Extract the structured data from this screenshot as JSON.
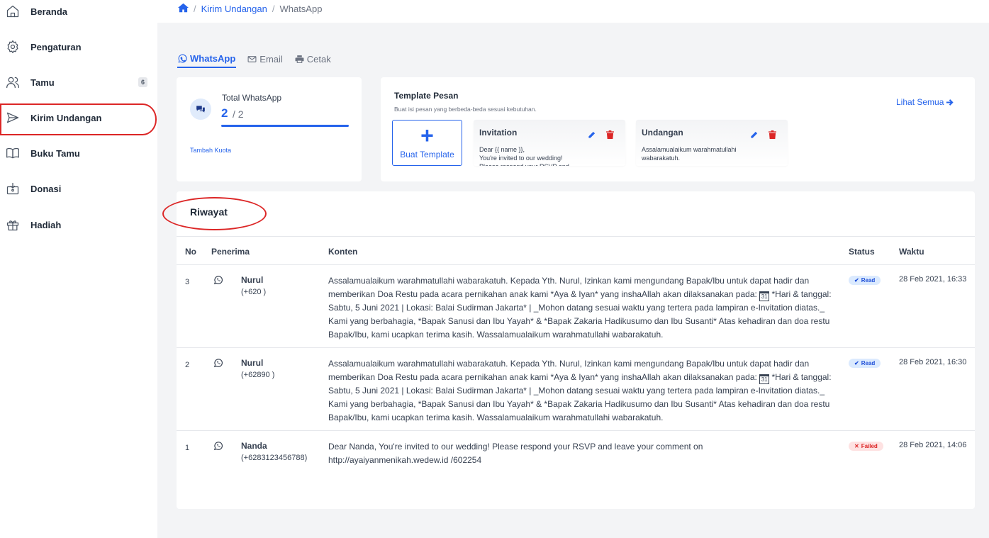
{
  "sidebar": {
    "items": [
      {
        "label": "Beranda",
        "icon": "home-icon"
      },
      {
        "label": "Pengaturan",
        "icon": "gear-icon"
      },
      {
        "label": "Tamu",
        "icon": "users-icon",
        "badge": "6"
      },
      {
        "label": "Kirim Undangan",
        "icon": "send-icon"
      },
      {
        "label": "Buku Tamu",
        "icon": "book-icon"
      },
      {
        "label": "Donasi",
        "icon": "donation-icon"
      },
      {
        "label": "Hadiah",
        "icon": "gift-icon"
      }
    ]
  },
  "breadcrumb": {
    "link": "Kirim Undangan",
    "current": "WhatsApp"
  },
  "tabs": [
    {
      "label": "WhatsApp",
      "icon": "whatsapp-icon",
      "active": true
    },
    {
      "label": "Email",
      "icon": "mail-icon",
      "active": false
    },
    {
      "label": "Cetak",
      "icon": "printer-icon",
      "active": false
    }
  ],
  "whatsapp_card": {
    "title": "Total WhatsApp",
    "used": "2",
    "total": "/ 2",
    "progress": 1.0,
    "link": "Tambah Kuota"
  },
  "template_card": {
    "title": "Template Pesan",
    "subtitle": "Buat isi pesan yang berbeda-beda sesuai kebutuhan.",
    "see_all": "Lihat Semua",
    "create_label": "Buat Template",
    "templates": [
      {
        "name": "Invitation",
        "body": "Dear {{ name }},\nYou're invited to our wedding!\nPlease respond your RSVP and"
      },
      {
        "name": "Undangan",
        "body": "Assalamualaikum warahmatullahi wabarakatuh."
      }
    ]
  },
  "history": {
    "title": "Riwayat",
    "columns": [
      "No",
      "Penerima",
      "Konten",
      "Status",
      "Waktu"
    ],
    "rows": [
      {
        "no": "3",
        "name": "Nurul",
        "phone": "(+620            )",
        "content_before": "Assalamualaikum warahmatullahi wabarakatuh. Kepada Yth. Nurul, Izinkan kami mengundang Bapak/Ibu untuk dapat hadir dan memberikan Doa Restu pada acara pernikahan anak kami *Aya & Iyan* yang inshaAllah akan dilaksanakan pada: ",
        "content_after": " *Hari & tanggal: Sabtu, 5 Juni 2021 | Lokasi: Balai Sudirman Jakarta* | _Mohon datang sesuai waktu yang tertera pada lampiran e-Invitation diatas._ Kami yang berbahagia, *Bapak Sanusi dan Ibu Yayah* & *Bapak Zakaria Hadikusumo dan Ibu Susanti* Atas kehadiran dan doa restu Bapak/Ibu, kami ucapkan terima kasih. Wassalamualaikum warahmatullahi wabarakatuh.",
        "status": "Read",
        "time": "28 Feb 2021, 16:33"
      },
      {
        "no": "2",
        "name": "Nurul",
        "phone": "(+62890         )",
        "content_before": "Assalamualaikum warahmatullahi wabarakatuh. Kepada Yth. Nurul, Izinkan kami mengundang Bapak/Ibu untuk dapat hadir dan memberikan Doa Restu pada acara pernikahan anak kami *Aya & Iyan* yang inshaAllah akan dilaksanakan pada: ",
        "content_after": " *Hari & tanggal: Sabtu, 5 Juni 2021 | Lokasi: Balai Sudirman Jakarta* | _Mohon datang sesuai waktu yang tertera pada lampiran e-Invitation diatas._ Kami yang berbahagia, *Bapak Sanusi dan Ibu Yayah* & *Bapak Zakaria Hadikusumo dan Ibu Susanti* Atas kehadiran dan doa restu Bapak/Ibu, kami ucapkan terima kasih. Wassalamualaikum warahmatullahi wabarakatuh.",
        "status": "Read",
        "time": "28 Feb 2021, 16:30"
      },
      {
        "no": "1",
        "name": "Nanda",
        "phone": "(+6283123456788)",
        "content_before": "Dear Nanda, You're invited to our wedding! Please respond your RSVP and leave your comment on http://ayaiyanmenikah.wedew.id /602254",
        "content_after": "",
        "status": "Failed",
        "time": "28 Feb 2021, 14:06"
      }
    ]
  },
  "calendar_glyph": "31",
  "colors": {
    "accent": "#2563eb",
    "annotation": "#dc2626",
    "status_read": "#1d4ed8",
    "status_failed": "#dc2626"
  }
}
